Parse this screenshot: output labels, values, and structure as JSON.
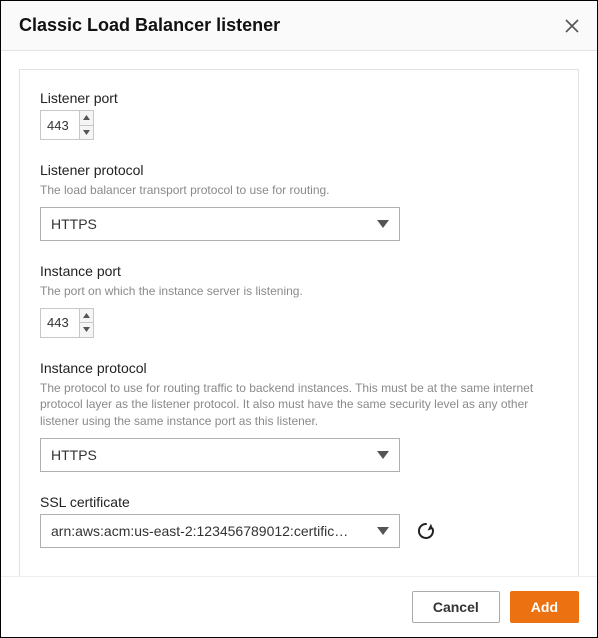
{
  "header": {
    "title": "Classic Load Balancer listener"
  },
  "fields": {
    "listenerPort": {
      "label": "Listener port",
      "value": "443"
    },
    "listenerProtocol": {
      "label": "Listener protocol",
      "help": "The load balancer transport protocol to use for routing.",
      "value": "HTTPS"
    },
    "instancePort": {
      "label": "Instance port",
      "help": "The port on which the instance server is listening.",
      "value": "443"
    },
    "instanceProtocol": {
      "label": "Instance protocol",
      "help": "The protocol to use for routing traffic to backend instances. This must be at the same internet protocol layer as the listener protocol. It also must have the same security level as any other listener using the same instance port as this listener.",
      "value": "HTTPS"
    },
    "sslCertificate": {
      "label": "SSL certificate",
      "value": "arn:aws:acm:us-east-2:123456789012:certific…"
    }
  },
  "footer": {
    "cancel": "Cancel",
    "add": "Add"
  }
}
